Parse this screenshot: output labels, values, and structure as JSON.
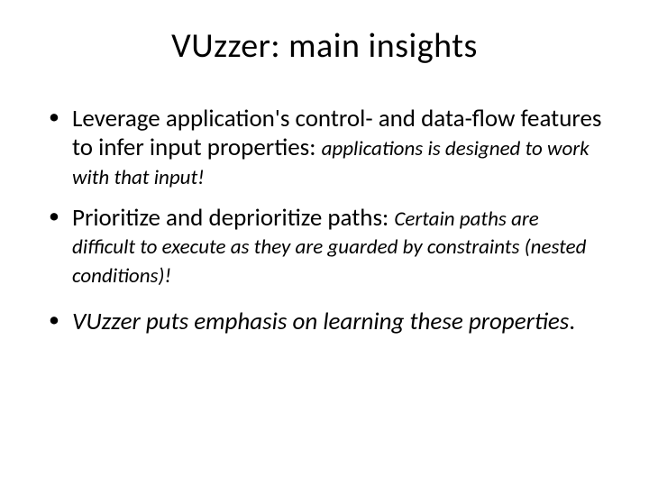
{
  "title": "VUzzer:  main insights",
  "bullets": {
    "b1": {
      "main": "Leverage application's control- and data-flow features to infer input properties: ",
      "sub": "applications is designed to work with that input!"
    },
    "b2": {
      "main": "Prioritize and deprioritize paths: ",
      "sub": "Certain paths are difficult to execute as they are guarded by constraints (nested conditions)!"
    },
    "b3": {
      "text": "VUzzer puts emphasis on learning these properties",
      "period": "."
    }
  }
}
